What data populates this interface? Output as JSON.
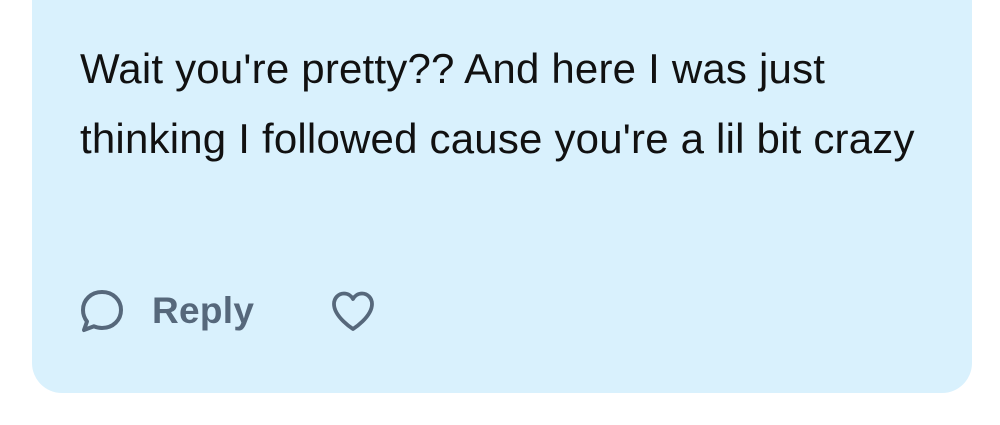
{
  "comment": {
    "text": "Wait you're pretty?? And here I was just thinking I followed cause you're a lil bit crazy"
  },
  "actions": {
    "reply_label": "Reply",
    "reply_icon": "speech-bubble-icon",
    "like_icon": "heart-icon"
  },
  "colors": {
    "card_background": "#d9f1fd",
    "text": "#111111",
    "action": "#56687b"
  }
}
